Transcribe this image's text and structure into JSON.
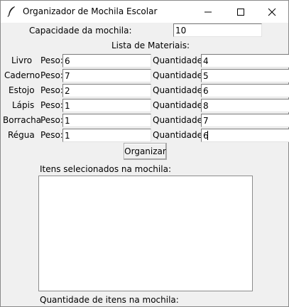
{
  "window": {
    "title": "Organizador de Mochila Escolar",
    "icon": "feather-icon",
    "controls": [
      "minimize-icon",
      "maximize-icon",
      "close-icon"
    ]
  },
  "capacity": {
    "label": "Capacidade da mochila:",
    "value": "10"
  },
  "materials_header": "Lista de Materiais:",
  "field_labels": {
    "weight": "Peso:",
    "quantity": "Quantidade:"
  },
  "materials": [
    {
      "name": "Livro",
      "weight": "6",
      "quantity": "4"
    },
    {
      "name": "Caderno",
      "weight": "7",
      "quantity": "5"
    },
    {
      "name": "Estojo",
      "weight": "2",
      "quantity": "6"
    },
    {
      "name": "Lápis",
      "weight": "1",
      "quantity": "8"
    },
    {
      "name": "Borracha",
      "weight": "1",
      "quantity": "7"
    },
    {
      "name": "Régua",
      "weight": "1",
      "quantity": "6"
    }
  ],
  "organize_button": "Organizar",
  "selected_label": "Itens selecionados na mochila:",
  "selected_items": "",
  "count_label": "Quantidade de itens na mochila:"
}
